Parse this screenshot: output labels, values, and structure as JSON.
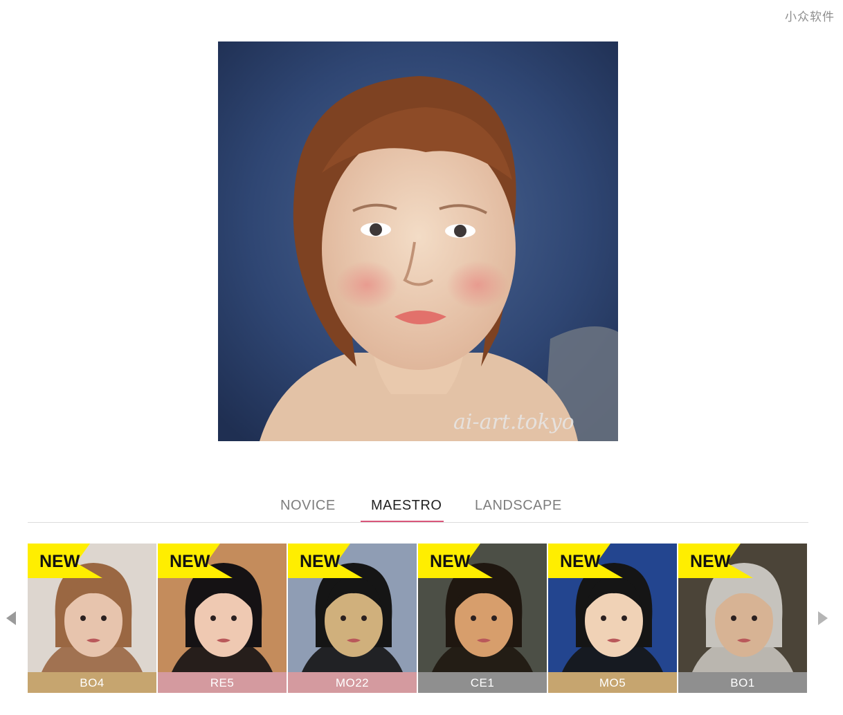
{
  "watermark": "小众软件",
  "portrait": {
    "signature": "ai-art.tokyo",
    "colors": {
      "background": "#2e4470",
      "skin": "#e8c3a6",
      "hair": "#8a4a26"
    }
  },
  "tabs": [
    {
      "label": "NOVICE",
      "active": false
    },
    {
      "label": "MAESTRO",
      "active": true
    },
    {
      "label": "LANDSCAPE",
      "active": false
    }
  ],
  "badge": {
    "label": "NEW",
    "color": "#ffee00"
  },
  "styles": [
    {
      "code": "BO4",
      "label_color": "#c6a56f",
      "bg": "#ddd6cf",
      "skin": "#e7c4ad",
      "hair": "#9a6742"
    },
    {
      "code": "RE5",
      "label_color": "#d49a9f",
      "bg": "#c48c5c",
      "skin": "#efc9b2",
      "hair": "#151214"
    },
    {
      "code": "MO22",
      "label_color": "#d49a9f",
      "bg": "#8f9db4",
      "skin": "#d0b07c",
      "hair": "#151515"
    },
    {
      "code": "CE1",
      "label_color": "#8f8f8f",
      "bg": "#4c4f46",
      "skin": "#d79e6c",
      "hair": "#1f1710"
    },
    {
      "code": "MO5",
      "label_color": "#c6a56f",
      "bg": "#23458f",
      "skin": "#f0d2b6",
      "hair": "#151515"
    },
    {
      "code": "BO1",
      "label_color": "#8f8f8f",
      "bg": "#4b4438",
      "skin": "#d7b394",
      "hair": "#c6c3bd"
    }
  ],
  "nav": {
    "prev_icon": "chevron-left-icon",
    "next_icon": "chevron-right-icon"
  }
}
